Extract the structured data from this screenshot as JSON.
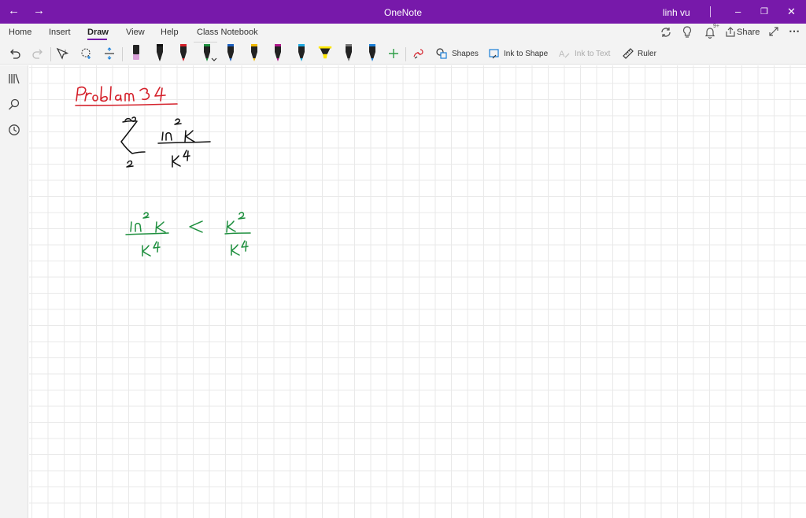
{
  "titlebar": {
    "back_icon": "back-arrow-icon",
    "forward_icon": "forward-arrow-icon",
    "title": "OneNote",
    "user": "linh vu",
    "minimize_icon": "minimize-icon",
    "restore_icon": "restore-icon",
    "close_icon": "close-icon",
    "background": "#7719aa"
  },
  "ribbon": {
    "tabs": [
      {
        "label": "Home"
      },
      {
        "label": "Insert"
      },
      {
        "label": "Draw",
        "active": true
      },
      {
        "label": "View"
      },
      {
        "label": "Help"
      },
      {
        "label": "Class Notebook"
      }
    ],
    "right": {
      "sync_icon": "sync-icon",
      "lightbulb_icon": "lightbulb-icon",
      "bell_icon": "bell-icon",
      "notification_count": "9+",
      "share_label": "Share",
      "expand_icon": "expand-icon",
      "more_icon": "more-icon"
    }
  },
  "toolbar": {
    "undo_icon": "undo-icon",
    "redo_icon": "redo-icon",
    "type_select_icon": "type-select-icon",
    "lasso_icon": "lasso-select-icon",
    "add_space_icon": "add-space-icon",
    "pens": [
      {
        "color": "#d9a0d8",
        "kind": "eraser"
      },
      {
        "color": "#111111",
        "kind": "pen"
      },
      {
        "color": "#d4202a",
        "kind": "pen"
      },
      {
        "color": "#1e8f3e",
        "kind": "pen",
        "selected": true
      },
      {
        "color": "#1b5fbf",
        "kind": "pen"
      },
      {
        "color": "#f0b800",
        "kind": "pen"
      },
      {
        "color": "#b0178a",
        "kind": "pen"
      },
      {
        "color": "#1da8e0",
        "kind": "pen"
      },
      {
        "color": "#ffe600",
        "kind": "highlighter"
      },
      {
        "color": "#777777",
        "kind": "pen"
      },
      {
        "color": "#1b7fd8",
        "kind": "pen"
      }
    ],
    "add_pen_icon": "plus-icon",
    "ink_replay_icon": "ink-replay-icon",
    "shapes_label": "Shapes",
    "ink_to_shape_label": "Ink to Shape",
    "ink_to_text_label": "Ink to Text",
    "ruler_label": "Ruler"
  },
  "sidebar": {
    "notebooks_icon": "notebooks-icon",
    "search_icon": "search-icon",
    "recent_icon": "clock-icon"
  },
  "page": {
    "ink_colors": {
      "red": "#d4202a",
      "black": "#111111",
      "green": "#1e8f3e"
    }
  }
}
